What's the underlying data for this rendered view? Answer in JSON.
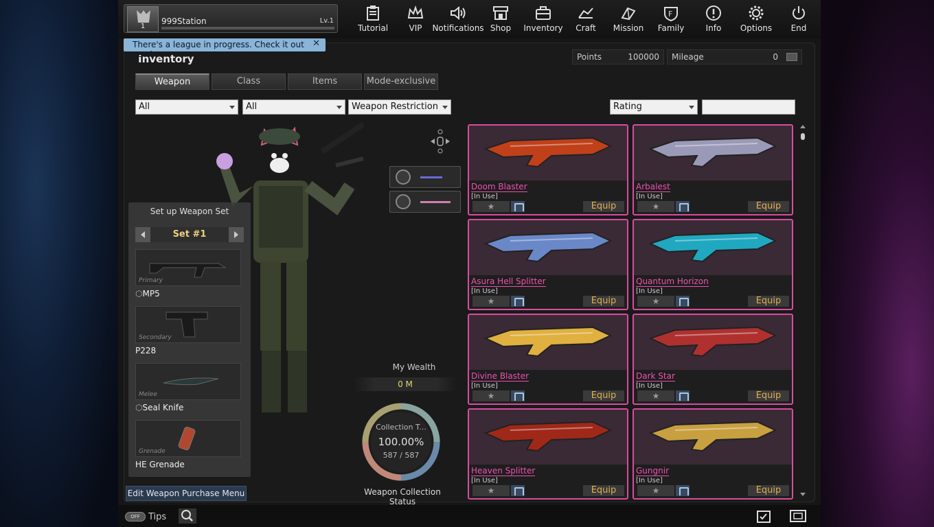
{
  "profile": {
    "rank": "1",
    "name": "999Station",
    "level": "Lv.1"
  },
  "nav": [
    {
      "label": "Tutorial",
      "icon": "tutorial-icon"
    },
    {
      "label": "VIP",
      "icon": "crown-icon"
    },
    {
      "label": "Notifications",
      "icon": "speaker-icon"
    },
    {
      "label": "Shop",
      "icon": "shop-icon"
    },
    {
      "label": "Inventory",
      "icon": "briefcase-icon"
    },
    {
      "label": "Craft",
      "icon": "craft-icon"
    },
    {
      "label": "Mission",
      "icon": "mission-icon"
    },
    {
      "label": "Family",
      "icon": "family-icon"
    },
    {
      "label": "Info",
      "icon": "info-icon"
    },
    {
      "label": "Options",
      "icon": "gear-icon"
    },
    {
      "label": "End",
      "icon": "power-icon"
    }
  ],
  "league_banner": {
    "text": "There's a league in progress. Check it out now!",
    "close": "✕"
  },
  "inventory": {
    "title": "Inventory",
    "points_label": "Points",
    "points_value": "100000",
    "mileage_label": "Mileage",
    "mileage_value": "0",
    "tabs": [
      "Weapon",
      "Class",
      "Items",
      "Mode-exclusive"
    ],
    "active_tab": "Weapon"
  },
  "filters": {
    "filter1": "All",
    "filter2": "All",
    "filter3": "Weapon Restriction ...",
    "sort": "Rating",
    "search": ""
  },
  "weapon_set": {
    "title": "Set up Weapon Set",
    "set_label": "Set #1",
    "slots": [
      {
        "kind": "Primary",
        "name": "MP5",
        "marked": true
      },
      {
        "kind": "Secondary",
        "name": "P228",
        "marked": false
      },
      {
        "kind": "Melee",
        "name": "Seal Knife",
        "marked": true
      },
      {
        "kind": "Grenade",
        "name": "HE Grenade",
        "marked": false
      }
    ],
    "edit_menu": "Edit Weapon Purchase Menu"
  },
  "wealth": {
    "label": "My Wealth",
    "value": "0 M",
    "collection_label": "Collection T...",
    "collection_percent": "100.00%",
    "collection_count": "587 / 587",
    "collection_status": "Weapon Collection Status"
  },
  "weapons": [
    {
      "name": "Doom Blaster",
      "status": "[In Use]",
      "equip": "Equip",
      "color": "#c0401a"
    },
    {
      "name": "Arbalest",
      "status": "[In Use]",
      "equip": "Equip",
      "color": "#9a9ab8"
    },
    {
      "name": "Asura Hell Splitter",
      "status": "[In Use]",
      "equip": "Equip",
      "color": "#6a88c8"
    },
    {
      "name": "Quantum Horizon",
      "status": "[In Use]",
      "equip": "Equip",
      "color": "#20a8c0"
    },
    {
      "name": "Divine Blaster",
      "status": "[In Use]",
      "equip": "Equip",
      "color": "#e0b040"
    },
    {
      "name": "Dark Star",
      "status": "[In Use]",
      "equip": "Equip",
      "color": "#b03030"
    },
    {
      "name": "Heaven Splitter",
      "status": "[In Use]",
      "equip": "Equip",
      "color": "#a02818"
    },
    {
      "name": "Gungnir",
      "status": "[In Use]",
      "equip": "Equip",
      "color": "#c8a040"
    }
  ],
  "bottom": {
    "tips_toggle": "OFF",
    "tips": "Tips"
  }
}
